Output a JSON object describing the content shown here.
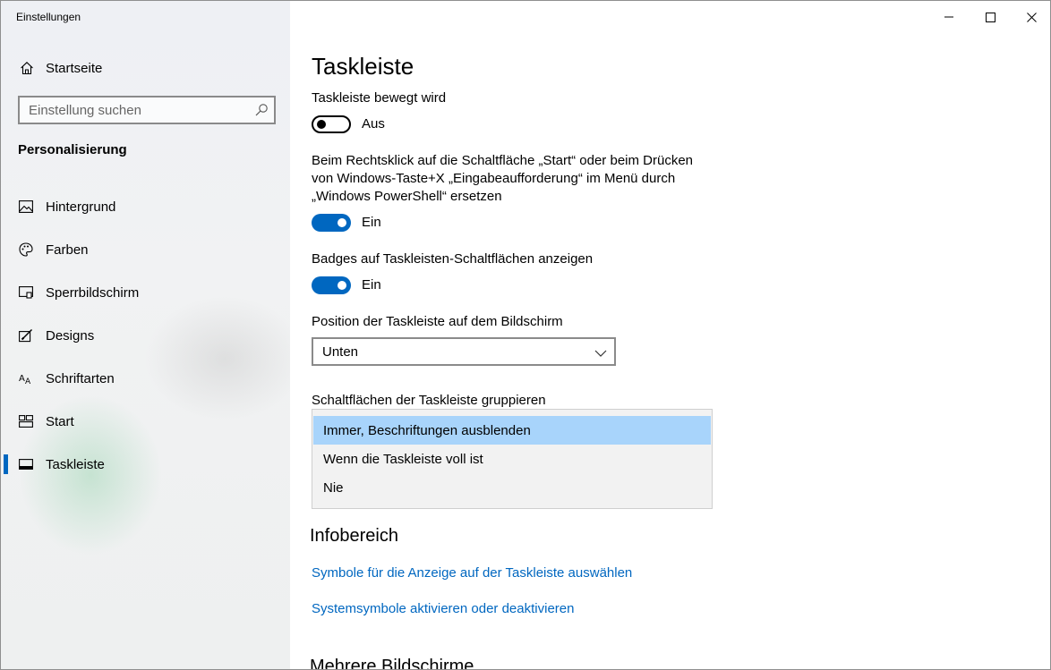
{
  "window": {
    "title": "Einstellungen"
  },
  "sidebar": {
    "home_label": "Startseite",
    "search_placeholder": "Einstellung suchen",
    "section": "Personalisierung",
    "items": [
      {
        "label": "Hintergrund",
        "icon": "picture-icon"
      },
      {
        "label": "Farben",
        "icon": "palette-icon"
      },
      {
        "label": "Sperrbildschirm",
        "icon": "lockscreen-icon"
      },
      {
        "label": "Designs",
        "icon": "brush-icon"
      },
      {
        "label": "Schriftarten",
        "icon": "font-icon"
      },
      {
        "label": "Start",
        "icon": "start-icon"
      },
      {
        "label": "Taskleiste",
        "icon": "taskbar-icon",
        "active": true
      }
    ]
  },
  "main": {
    "title": "Taskleiste",
    "setting1": {
      "label": "Taskleiste bewegt wird",
      "state": "Aus"
    },
    "setting2": {
      "line1": "Beim Rechtsklick auf die Schaltfläche „Start“ oder beim Drücken",
      "line2": "von Windows-Taste+X „Eingabeaufforderung“ im Menü durch",
      "line3": "„Windows PowerShell“ ersetzen",
      "state": "Ein"
    },
    "setting3": {
      "label": "Badges auf Taskleisten-Schaltflächen anzeigen",
      "state": "Ein"
    },
    "position": {
      "label": "Position der Taskleiste auf dem Bildschirm",
      "value": "Unten"
    },
    "grouping": {
      "label": "Schaltflächen der Taskleiste gruppieren",
      "options": [
        "Immer, Beschriftungen ausblenden",
        "Wenn die Taskleiste voll ist",
        "Nie"
      ],
      "selected": "Immer, Beschriftungen ausblenden"
    },
    "infobereich": {
      "heading": "Infobereich",
      "link1": "Symbole für die Anzeige auf der Taskleiste auswählen",
      "link2": "Systemsymbole aktivieren oder deaktivieren"
    },
    "next_heading": "Mehrere Bildschirme"
  },
  "colors": {
    "accent": "#0067c0",
    "selection": "#a8d4fb"
  }
}
